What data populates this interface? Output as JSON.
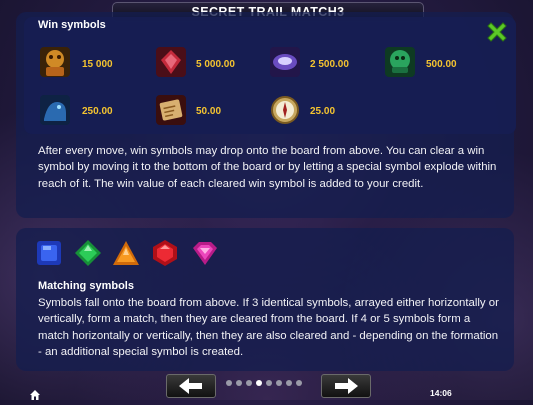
{
  "title": "SECRET TRAIL MATCH3",
  "win_symbols": {
    "heading": "Win symbols",
    "items": [
      {
        "icon": "tiger-statue-icon",
        "value": "15 000",
        "color": "#c8741c"
      },
      {
        "icon": "red-gem-fire-icon",
        "value": "5 000.00",
        "color": "#b2283a"
      },
      {
        "icon": "purple-crystal-icon",
        "value": "2 500.00",
        "color": "#5a3da0"
      },
      {
        "icon": "green-idol-icon",
        "value": "500.00",
        "color": "#2a9a5a"
      },
      {
        "icon": "blue-panther-icon",
        "value": "250.00",
        "color": "#2a6ab0"
      },
      {
        "icon": "treasure-map-icon",
        "value": "50.00",
        "color": "#b0783a"
      },
      {
        "icon": "compass-icon",
        "value": "25.00",
        "color": "#c0a060"
      }
    ],
    "description": "After every move, win symbols may drop onto the board from above. You can clear a win symbol by moving it to the bottom of the board or by letting a special symbol explode within reach of it. The win value of each cleared win symbol is added to your credit."
  },
  "matching_symbols": {
    "heading": "Matching symbols",
    "gems": [
      {
        "icon": "blue-square-gem-icon",
        "color": "#2a4fd8"
      },
      {
        "icon": "green-diamond-gem-icon",
        "color": "#23b04a"
      },
      {
        "icon": "orange-triangle-gem-icon",
        "color": "#f08a16"
      },
      {
        "icon": "red-hexagon-gem-icon",
        "color": "#e0202c"
      },
      {
        "icon": "pink-heart-gem-icon",
        "color": "#e02fa8"
      }
    ],
    "description": "Symbols fall onto the board from above. If 3 identical symbols, arrayed either horizontally or vertically, form a match, then they are cleared from the board. If 4 or 5 symbols form a match horizontally or vertically, then they are also cleared and - depending on the formation - an additional special symbol is created."
  },
  "navigation": {
    "prev_icon": "arrow-left-icon",
    "next_icon": "arrow-right-icon",
    "page_count": 8,
    "current_page": 4
  },
  "status_bar": {
    "home_icon": "home-icon",
    "time": "14:06"
  },
  "colors": {
    "value_gold": "#f5c430",
    "close_green": "#5cc828",
    "panel_blue": "#141e4e"
  }
}
